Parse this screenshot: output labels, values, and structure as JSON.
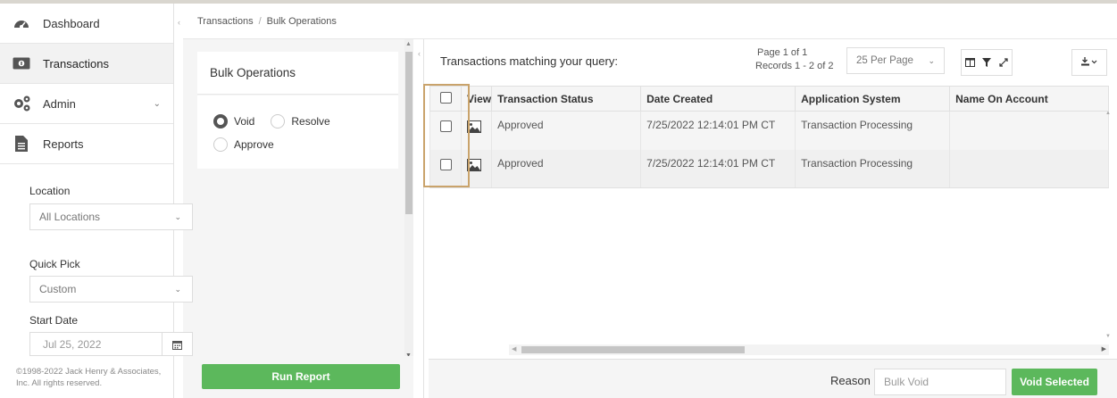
{
  "sidebar": {
    "items": [
      {
        "label": "Dashboard",
        "icon": "dashboard-gauge-icon"
      },
      {
        "label": "Transactions",
        "icon": "money-icon"
      },
      {
        "label": "Admin",
        "icon": "gears-icon"
      },
      {
        "label": "Reports",
        "icon": "document-icon"
      }
    ],
    "copyright": "©1998-2022 Jack Henry & Associates, Inc. All rights reserved."
  },
  "breadcrumb": {
    "root": "Transactions",
    "separator": "/",
    "current": "Bulk Operations"
  },
  "filter": {
    "title": "Bulk Operations",
    "radios": {
      "void": "Void",
      "resolve": "Resolve",
      "approve": "Approve",
      "selected": "Void"
    },
    "location": {
      "label": "Location",
      "value": "All Locations"
    },
    "quick_pick": {
      "label": "Quick Pick",
      "value": "Custom"
    },
    "start_date": {
      "label": "Start Date",
      "value": "Jul 25, 2022"
    },
    "run_button": "Run Report"
  },
  "grid": {
    "title": "Transactions matching your query:",
    "page": "Page 1 of 1",
    "records": "Records 1 - 2 of 2",
    "per_page": "25 Per Page",
    "columns": [
      "View",
      "Transaction Status",
      "Date Created",
      "Application System",
      "Name On Account"
    ],
    "rows": [
      {
        "status": "Approved",
        "date": "7/25/2022 12:14:01 PM CT",
        "system": "Transaction Processing",
        "name": ""
      },
      {
        "status": "Approved",
        "date": "7/25/2022 12:14:01 PM CT",
        "system": "Transaction Processing",
        "name": ""
      }
    ]
  },
  "footer": {
    "reason_label": "Reason",
    "reason_value": "Bulk Void",
    "void_button": "Void Selected"
  },
  "colors": {
    "accent_green": "#5cb85c",
    "highlight": "#c9a36b"
  }
}
